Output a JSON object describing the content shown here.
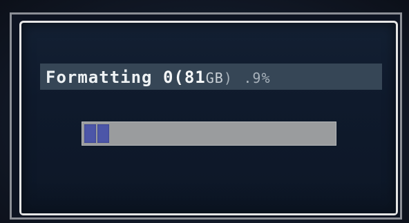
{
  "dialog": {
    "status_word": "Formatting",
    "progress_count": "0",
    "capacity_value": "(81",
    "capacity_unit": "GB",
    "capacity_close": ")",
    "percent_text": ".9%",
    "progress_fraction": 0.09,
    "progress_segments_shown": 2
  },
  "colors": {
    "dialog_border": "#e6e6e6",
    "progress_track": "#9a9c9e",
    "progress_fill": "#4c56a8",
    "title_strip": "#3a4a5a"
  }
}
